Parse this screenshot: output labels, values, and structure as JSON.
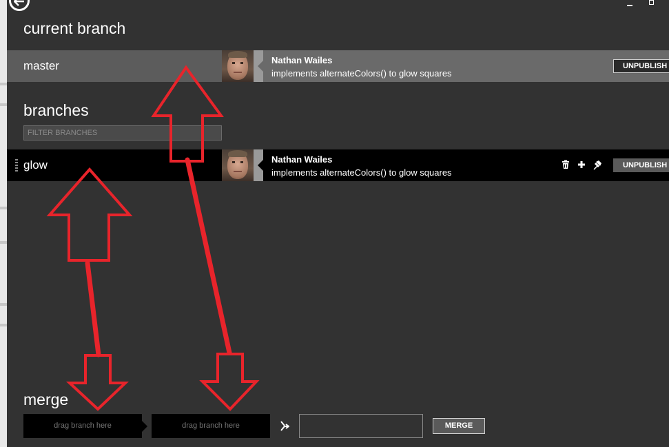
{
  "current_section": {
    "title": "current branch",
    "branch": {
      "name": "master",
      "author": "Nathan Wailes",
      "message": "implements alternateColors() to glow squares",
      "action_label": "UNPUBLISH"
    }
  },
  "branches_section": {
    "title": "branches",
    "filter_placeholder": "FILTER BRANCHES",
    "items": [
      {
        "name": "glow",
        "author": "Nathan Wailes",
        "message": "implements alternateColors() to glow squares",
        "action_label": "UNPUBLISH",
        "icons": [
          "trash-icon",
          "plus-icon",
          "pin-icon"
        ]
      }
    ]
  },
  "merge_section": {
    "title": "merge",
    "source_placeholder": "drag branch here",
    "target_placeholder": "drag branch here",
    "button_label": "MERGE"
  },
  "colors": {
    "background": "#323232",
    "current_row": "#5c5c5c",
    "branch_row": "#000000",
    "annotation_arrows": "#e8242b"
  }
}
